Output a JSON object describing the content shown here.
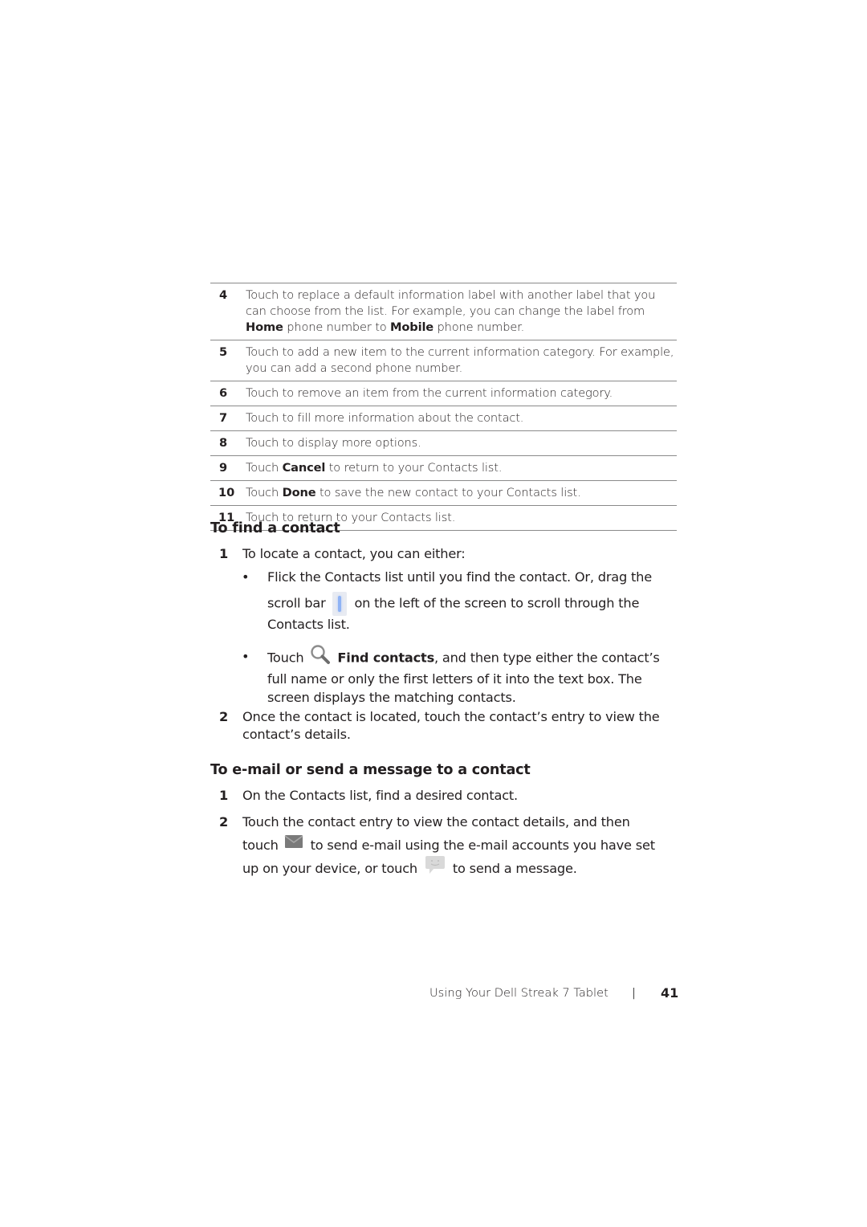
{
  "callout_table": [
    {
      "num": "4",
      "parts": [
        {
          "text": "Touch to replace a default information label with another label that you can choose from the list. For example, you can change the label from "
        },
        {
          "text": "Home",
          "bold": true
        },
        {
          "text": " phone number to "
        },
        {
          "text": "Mobile",
          "bold": true
        },
        {
          "text": " phone number."
        }
      ]
    },
    {
      "num": "5",
      "parts": [
        {
          "text": "Touch to add a new item to the current information category. For example, you can add a second phone number."
        }
      ]
    },
    {
      "num": "6",
      "parts": [
        {
          "text": "Touch to remove an item from the current information category."
        }
      ]
    },
    {
      "num": "7",
      "parts": [
        {
          "text": "Touch to fill more information about the contact."
        }
      ]
    },
    {
      "num": "8",
      "parts": [
        {
          "text": "Touch to display more options."
        }
      ]
    },
    {
      "num": "9",
      "parts": [
        {
          "text": "Touch "
        },
        {
          "text": "Cancel",
          "bold": true
        },
        {
          "text": " to return to your Contacts list."
        }
      ]
    },
    {
      "num": "10",
      "parts": [
        {
          "text": "Touch "
        },
        {
          "text": "Done",
          "bold": true
        },
        {
          "text": " to save the new contact to your Contacts list."
        }
      ]
    },
    {
      "num": "11",
      "parts": [
        {
          "text": "Touch to return to your Contacts list."
        }
      ]
    }
  ],
  "find_section": {
    "heading": "To find a contact",
    "step1": {
      "num": "1",
      "text": "To locate a contact, you can either:"
    },
    "bullet1": {
      "dot": "•",
      "line1": "Flick the Contacts list until you find the contact. Or, drag the",
      "line2_before": "scroll bar",
      "line2_after": "on the left of the screen to scroll through the",
      "line3": "Contacts list.",
      "icon": "scrollbar-icon"
    },
    "bullet2": {
      "dot": "•",
      "before": "Touch",
      "bold": "Find contacts",
      "after": ", and then type either the contact’s",
      "line2": "full name or only the first letters of it into the text box. The",
      "line3": "screen displays the matching contacts.",
      "icon": "search-icon"
    },
    "step2": {
      "num": "2",
      "line1": "Once the contact is located, touch the contact’s entry to view the",
      "line2": "contact’s details."
    }
  },
  "email_section": {
    "heading": "To e-mail or send a message to a contact",
    "step1": {
      "num": "1",
      "text": "On the Contacts list, find a desired contact."
    },
    "step2": {
      "num": "2",
      "line1": "Touch the contact entry to view the contact details, and then",
      "line2_before": "touch",
      "line2_after": "to send e-mail using the e-mail accounts you have set",
      "line3_before": "up on your device, or touch",
      "line3_after": "to send a message.",
      "icons": [
        "email-icon",
        "message-icon"
      ]
    }
  },
  "footer": {
    "title": "Using Your Dell Streak 7 Tablet",
    "separator": "|",
    "page_number": "41"
  }
}
